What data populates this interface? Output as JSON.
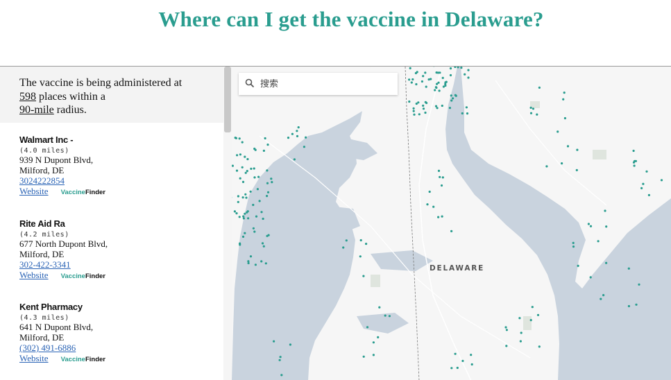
{
  "page": {
    "title": "Where can I get the vaccine in Delaware?"
  },
  "summary": {
    "prefix": "The vaccine is being administered at",
    "count": "598",
    "middle": "places within a",
    "radius": "90-mile",
    "suffix": "radius."
  },
  "locations": [
    {
      "name": "Walmart Inc -",
      "distance": "(4.0 miles)",
      "address1": "939 N Dupont Blvd,",
      "address2": "Milford, DE",
      "phone": "3024222854",
      "website": "Website",
      "finder": {
        "part1": "Vaccine",
        "part2": "Finder"
      }
    },
    {
      "name": "Rite Aid Ra",
      "distance": "(4.2 miles)",
      "address1": "677 North Dupont Blvd,",
      "address2": "Milford, DE",
      "phone": "302-422-3341",
      "website": "Website",
      "finder": {
        "part1": "Vaccine",
        "part2": "Finder"
      }
    },
    {
      "name": "Kent Pharmacy",
      "distance": "(4.3 miles)",
      "address1": "641 N Dupont Blvd,",
      "address2": "Milford, DE",
      "phone": "(302) 491-6886",
      "website": "Website",
      "finder": {
        "part1": "Vaccine",
        "part2": "Finder"
      }
    }
  ],
  "map": {
    "search_placeholder": "搜索",
    "state_label": "DELAWARE",
    "search_icon": "magnifier-icon",
    "colors": {
      "water": "#c9d3de",
      "land": "#f6f6f6",
      "dot": "#2a9d8f",
      "park": "#dfe5de"
    }
  }
}
